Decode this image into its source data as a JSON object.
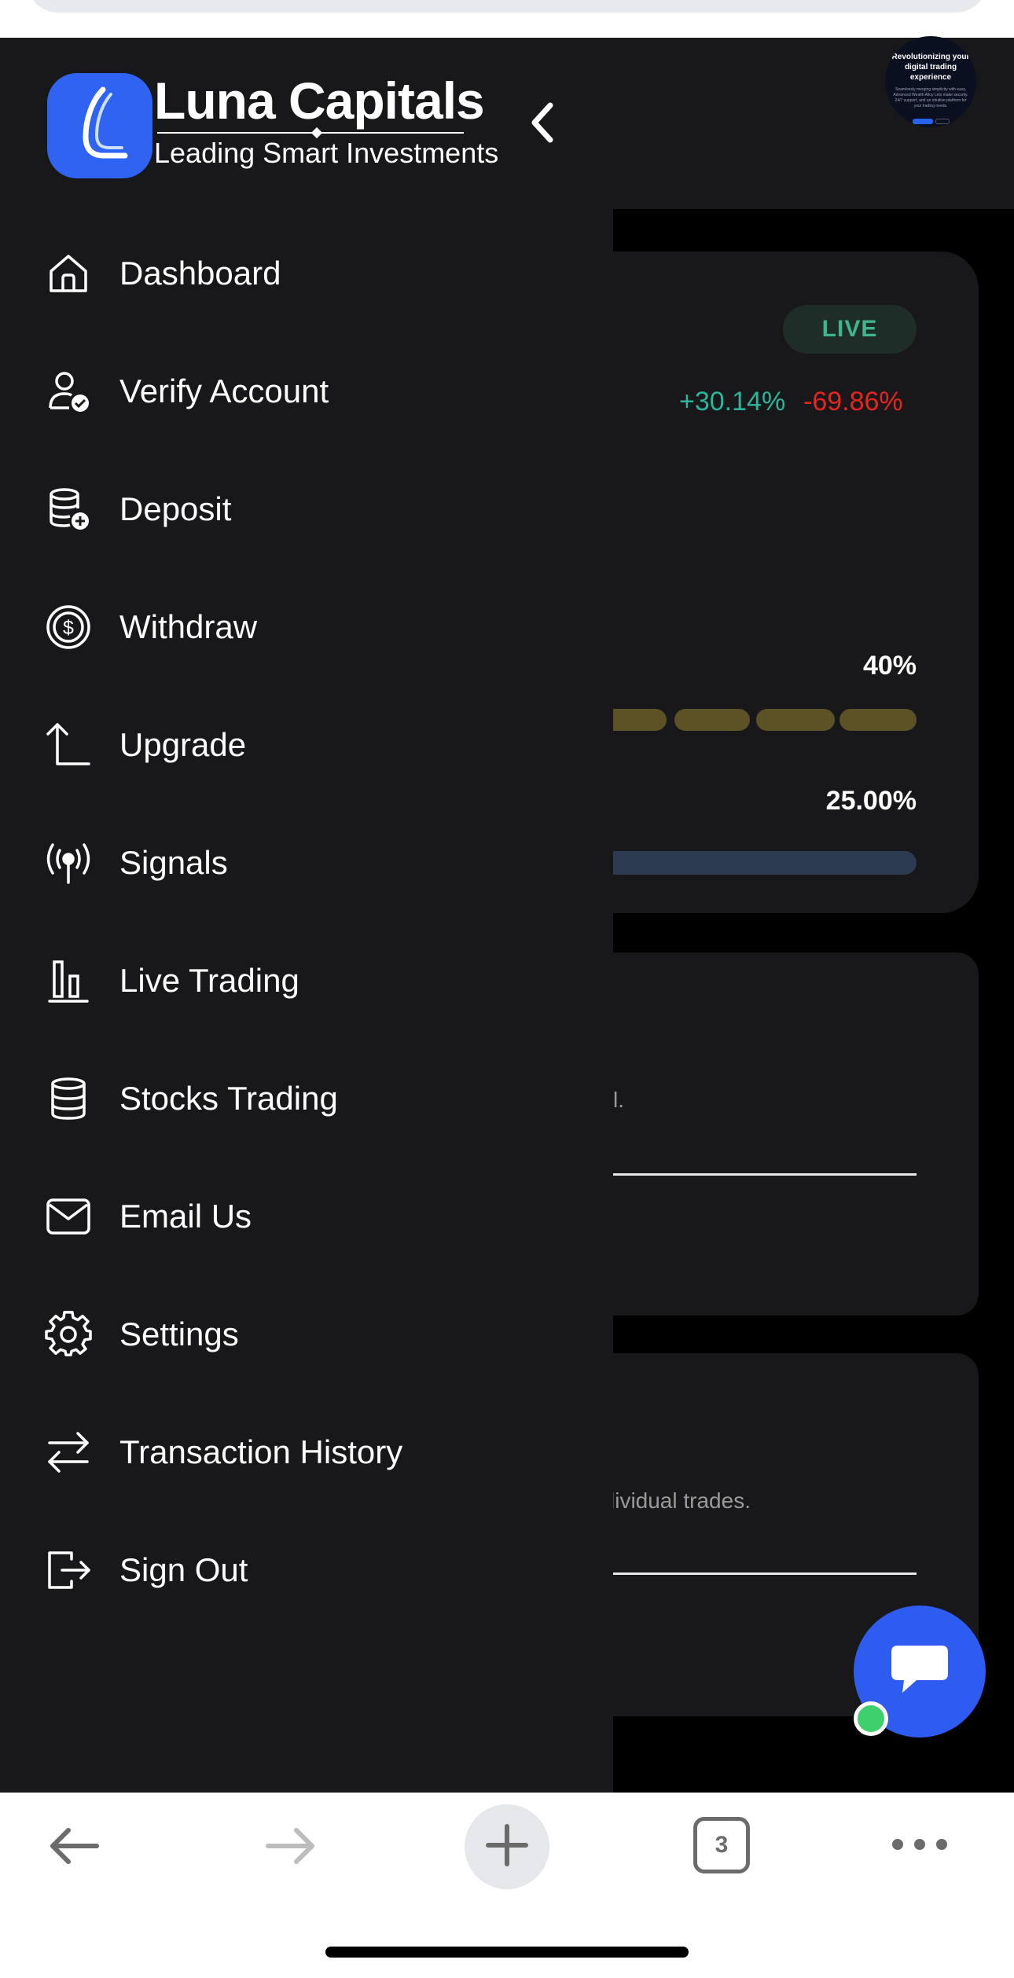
{
  "brand": {
    "name": "Luna Capitals",
    "tagline": "Leading Smart Investments"
  },
  "promo": {
    "title": "Revolutionizing your digital trading experience",
    "text": "Seamlessly merging simplicity with easy, Advanced Wealth Alloy Lets make security. 24/7 support, and an intuitive platform for your trading needs."
  },
  "sidebar": {
    "items": [
      {
        "label": "Dashboard",
        "icon": "home-icon"
      },
      {
        "label": "Verify Account",
        "icon": "user-check-icon"
      },
      {
        "label": "Deposit",
        "icon": "coins-plus-icon"
      },
      {
        "label": "Withdraw",
        "icon": "dollar-circle-icon"
      },
      {
        "label": "Upgrade",
        "icon": "arrow-up-corner-icon"
      },
      {
        "label": "Signals",
        "icon": "broadcast-icon"
      },
      {
        "label": "Live Trading",
        "icon": "bar-chart-icon"
      },
      {
        "label": "Stocks Trading",
        "icon": "database-icon"
      },
      {
        "label": "Email Us",
        "icon": "mail-icon"
      },
      {
        "label": "Settings",
        "icon": "gear-icon"
      },
      {
        "label": "Transaction History",
        "icon": "swap-arrows-icon"
      },
      {
        "label": "Sign Out",
        "icon": "logout-icon"
      }
    ]
  },
  "card1": {
    "badge": "LIVE",
    "pct_up": "+30.14%",
    "pct_down": "-69.86%",
    "progress_label_1": "40%",
    "progress_value_1": 0.4,
    "progress_label_2": "25.00%",
    "progress_value_2": 0.25
  },
  "card2": {
    "text_fragment": "l."
  },
  "card3": {
    "text_fragment": "lividual trades."
  },
  "browser": {
    "tab_count": "3"
  },
  "colors": {
    "accent_blue": "#2f63f2",
    "up_green": "#2bb59a",
    "down_red": "#e5251f",
    "drawer_bg": "#18181b"
  }
}
